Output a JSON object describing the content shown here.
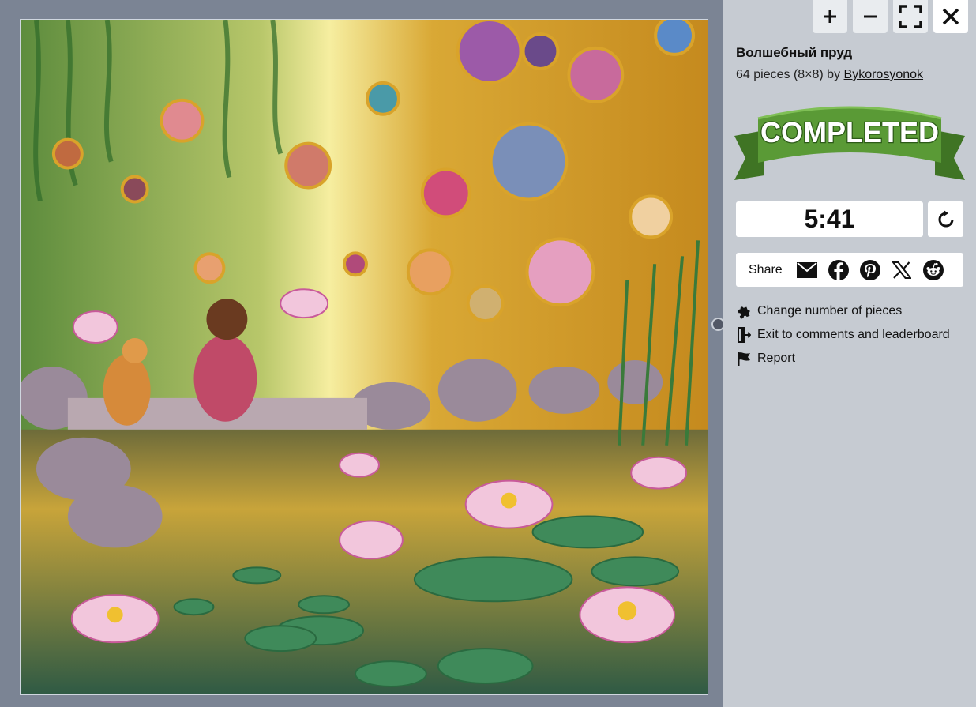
{
  "puzzle": {
    "title": "Волшебный пруд",
    "meta_prefix": "64 pieces (8×8) by ",
    "author": "Bykorosyonok",
    "image_description_icon": "puzzle-image"
  },
  "toolbar": {
    "zoom_in_icon": "plus-icon",
    "zoom_out_icon": "minus-icon",
    "fullscreen_icon": "fullscreen-icon",
    "close_icon": "close-icon"
  },
  "status": {
    "completed_label": "COMPLETED",
    "ribbon_color": "#4e8a2e"
  },
  "timer": {
    "value": "5:41"
  },
  "share": {
    "label": "Share",
    "icons": [
      "email-icon",
      "facebook-icon",
      "pinterest-icon",
      "x-icon",
      "reddit-icon"
    ]
  },
  "actions": {
    "change_pieces": "Change number of pieces",
    "exit": "Exit to comments and leaderboard",
    "report": "Report"
  },
  "colors": {
    "background": "#7b8494",
    "sidebar": "#c6cbd2",
    "ribbon": "#4e8a2e"
  }
}
